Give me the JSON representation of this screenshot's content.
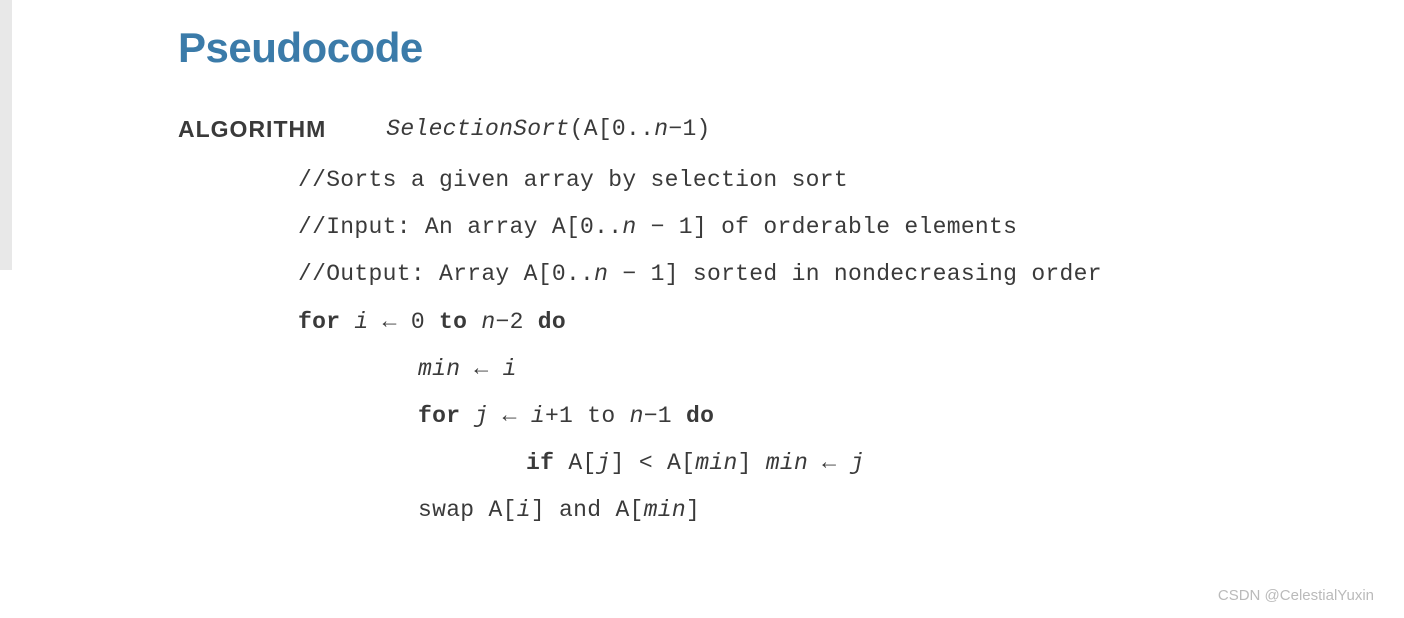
{
  "title": "Pseudocode",
  "algo_label": "ALGORITHM",
  "sig_pre": "SelectionSort",
  "sig_post": "(A[0..",
  "sig_n": "n",
  "sig_end": "−1)",
  "c1": "//Sorts a given array by selection sort",
  "c2_a": "//Input: An array A[0..",
  "c2_n": "n",
  "c2_b": " − 1] of orderable elements",
  "c3_a": "//Output: Array A[0..",
  "c3_n": "n",
  "c3_b": " − 1] sorted in nondecreasing order",
  "for1_for": "for ",
  "for1_i": "i",
  "for1_arrow": " ← 0 ",
  "for1_to": "to ",
  "for1_n": "n",
  "for1_minus": "−2 ",
  "for1_do": "do",
  "min_var": "min",
  "min_arrow": " ← ",
  "min_i": "i",
  "for2_for": "for ",
  "for2_j": "j",
  "for2_arrow": " ← ",
  "for2_i": "i",
  "for2_plus": "+1 to ",
  "for2_n": "n",
  "for2_minus": "−1 ",
  "for2_do": "do",
  "if_if": "if ",
  "if_aj": "A[",
  "if_j": "j",
  "if_close1": "] < A[",
  "if_min": "min",
  "if_close2": "] ",
  "if_min2": "min",
  "if_arrow": " ← ",
  "if_j2": "j",
  "swap_pre": "swap A[",
  "swap_i": "i",
  "swap_mid": "] and A[",
  "swap_min": "min",
  "swap_end": "]",
  "watermark": "CSDN @CelestialYuxin"
}
